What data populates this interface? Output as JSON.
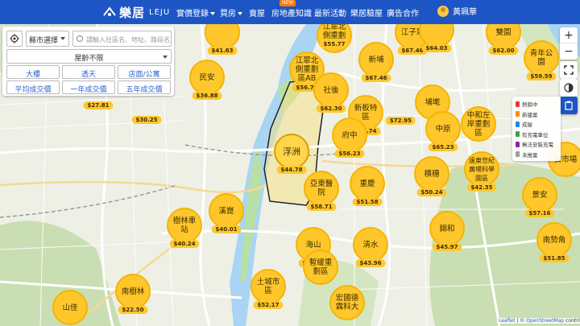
{
  "header": {
    "logo_text": "樂居",
    "logo_suffix": "LEJU",
    "nav": [
      {
        "label": "實價登錄",
        "has_caret": true
      },
      {
        "label": "買房",
        "has_caret": true
      },
      {
        "label": "賣屋",
        "has_caret": false
      },
      {
        "label": "房地產知識",
        "has_caret": false
      },
      {
        "label": "最新活動",
        "has_caret": false
      },
      {
        "label": "樂居驗屋",
        "has_caret": false
      },
      {
        "label": "廣告合作",
        "has_caret": false
      }
    ],
    "new_badge": "NEW",
    "user_name": "黃珮華"
  },
  "search_panel": {
    "city_select": "縣市選擇",
    "search_placeholder": "請輸入社區名、地址、路段名...",
    "age_select": "屋齡不限",
    "filters": [
      "大樓",
      "透天",
      "店面/公寓",
      "平均成交價",
      "一年成交價",
      "五年成交價"
    ]
  },
  "markers": [
    {
      "name": "",
      "price": "$41.63"
    },
    {
      "name": "江翠北側重劃區C",
      "price": ""
    },
    {
      "name": "江子翠",
      "price": "$67.46"
    },
    {
      "name": "",
      "price": "$64.03"
    },
    {
      "name": "雙園",
      "price": "$62.00"
    },
    {
      "name": "",
      "price": "$55.77"
    },
    {
      "name": "新埔",
      "price": "$67.46"
    },
    {
      "name": "江翠北側重劃區AB",
      "price": "$56.75"
    },
    {
      "name": "民安",
      "price": "$36.88"
    },
    {
      "name": "社後",
      "price": "$62.30"
    },
    {
      "name": "新板特區",
      "price": "$66.74"
    },
    {
      "name": "埔墘",
      "price": "$72.95"
    },
    {
      "name": "府中",
      "price": "$56.23"
    },
    {
      "name": "中原",
      "price": "$65.23"
    },
    {
      "name": "中和左岸重劃區",
      "price": ""
    },
    {
      "name": "青年公園",
      "price": "$59.59"
    },
    {
      "name": "浮洲",
      "price": "$44.78"
    },
    {
      "name": "亞東醫院",
      "price": "$58.71"
    },
    {
      "name": "重慶",
      "price": "$51.58"
    },
    {
      "name": "積穗",
      "price": "$50.24"
    },
    {
      "name": "遠東世紀廣場科學園區",
      "price": "$42.35"
    },
    {
      "name": "景安",
      "price": "$57.16"
    },
    {
      "name": "樹林車站",
      "price": "$40.24"
    },
    {
      "name": "溪崑",
      "price": "$40.01"
    },
    {
      "name": "海山",
      "price": "$61.01"
    },
    {
      "name": "清水",
      "price": "$43.96"
    },
    {
      "name": "錦和",
      "price": "$45.97"
    },
    {
      "name": "南勢角",
      "price": "$51.85"
    },
    {
      "name": "暫緩重劃區",
      "price": ""
    },
    {
      "name": "南樹林",
      "price": "$22.50"
    },
    {
      "name": "山佳",
      "price": ""
    },
    {
      "name": "土城市區",
      "price": "$52.17"
    },
    {
      "name": "宏國德霖科大",
      "price": ""
    },
    {
      "name": "",
      "price": "$27.81"
    },
    {
      "name": "",
      "price": "$30.25"
    },
    {
      "name": "安市場",
      "price": ""
    }
  ],
  "legend": {
    "items": [
      {
        "label": "熱銷中",
        "color": "#e53935"
      },
      {
        "label": "新建案",
        "color": "#fb8c00"
      },
      {
        "label": "成屋",
        "color": "#1e88e5"
      },
      {
        "label": "有充電車位",
        "color": "#43a047"
      },
      {
        "label": "無法安裝充電",
        "color": "#8e24aa"
      },
      {
        "label": "未推案",
        "color": "#9e9e9e"
      }
    ]
  },
  "attribution": {
    "leaflet": "Leaflet",
    "sep": " | © ",
    "osm": "OpenStreetMap",
    "rest": " contributors"
  },
  "colors": {
    "brand": "#1d56c4",
    "marker": "#ffc72c",
    "water": "#a9d4f3"
  }
}
